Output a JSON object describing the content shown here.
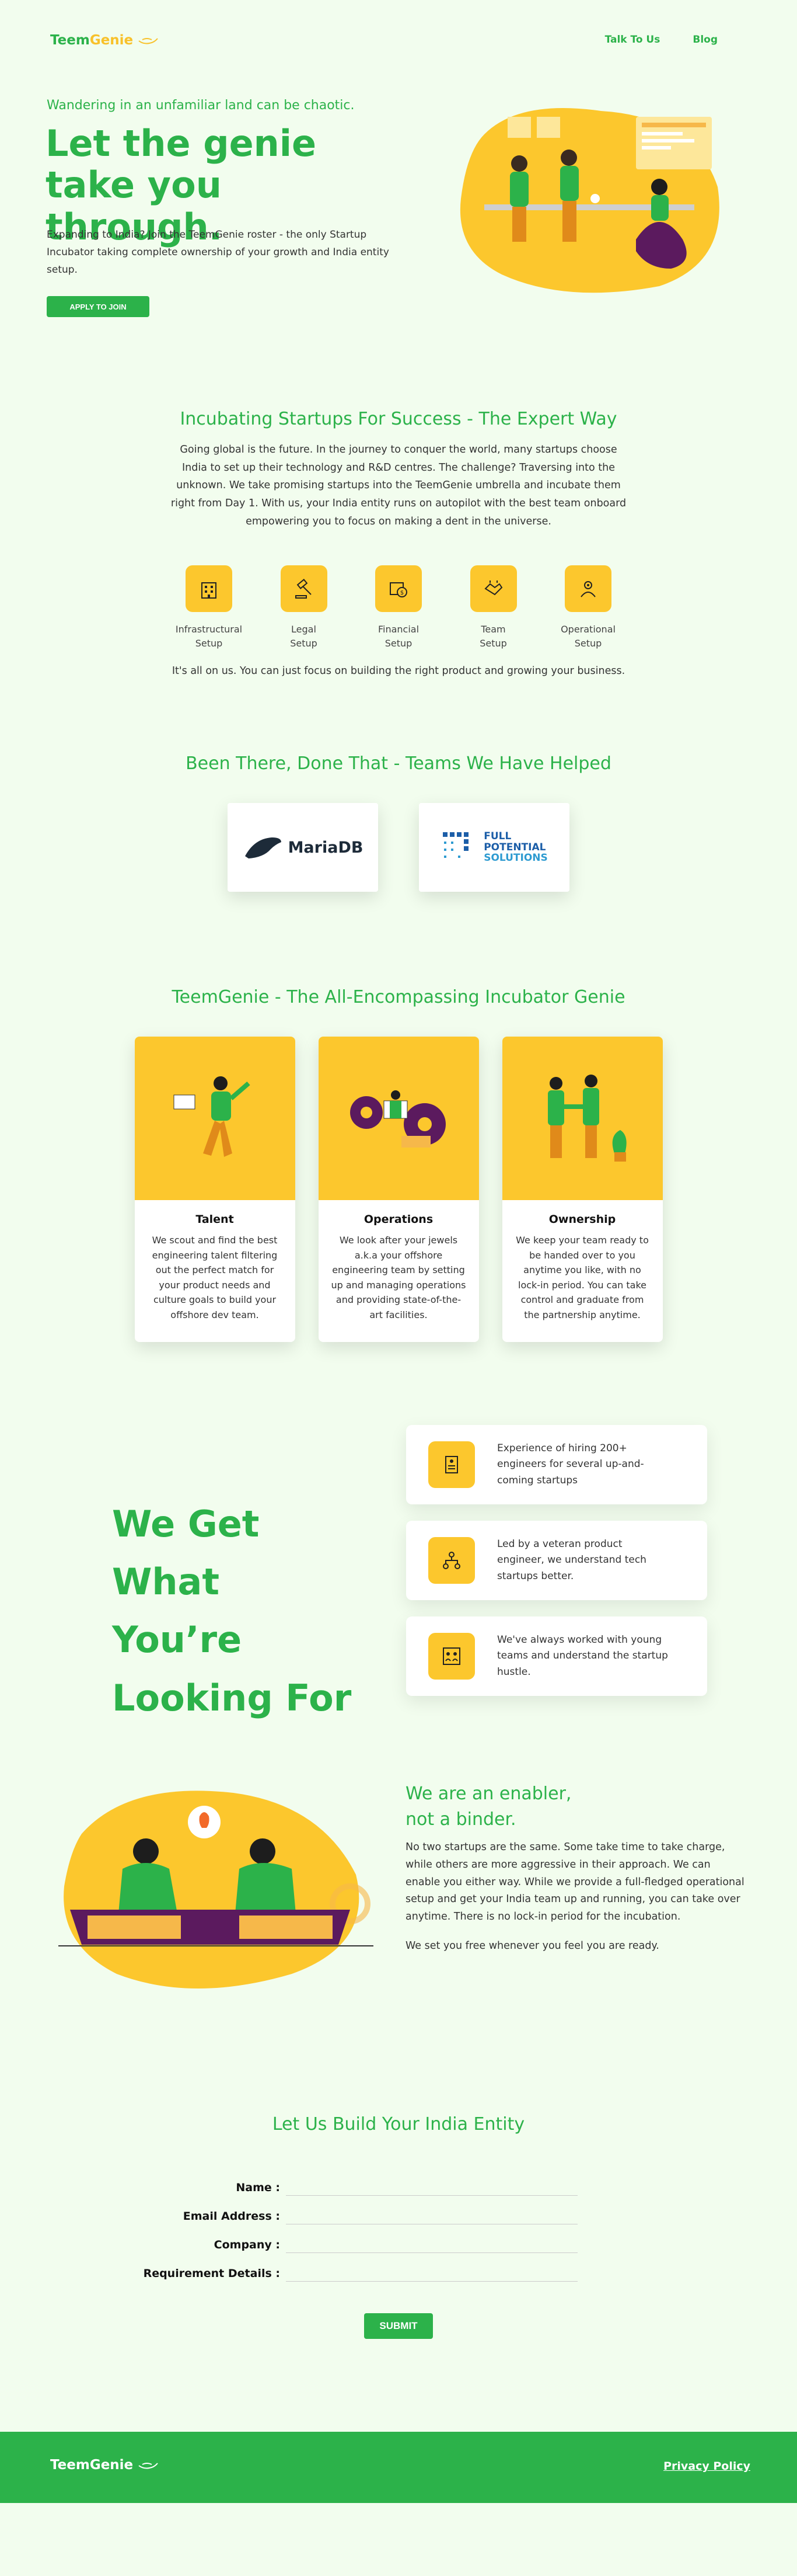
{
  "brand": {
    "name_part1": "Teem",
    "name_part2": "Genie"
  },
  "nav": {
    "talk": "Talk To Us",
    "blog": "Blog"
  },
  "hero": {
    "tagline": "Wandering in an unfamiliar land can be chaotic.",
    "title": "Let the genie take you through.",
    "description": "Expanding to India? Join the TeemGenie roster - the only Startup Incubator taking complete ownership of your growth and India entity setup.",
    "cta": "APPLY TO JOIN"
  },
  "incubating": {
    "title": "Incubating Startups For Success - The Expert Way",
    "body": "Going global is the future. In the journey to conquer the world, many startups choose India to set up their technology and R&D centres. The challenge? Traversing into the unknown. We take promising startups into the TeemGenie umbrella and incubate them right from Day 1. With us, your India entity runs on autopilot with the best team onboard empowering you to focus on making a dent in the universe.",
    "features": [
      {
        "line1": "Infrastructural",
        "line2": "Setup",
        "icon": "building-icon"
      },
      {
        "line1": "Legal",
        "line2": "Setup",
        "icon": "gavel-icon"
      },
      {
        "line1": "Financial",
        "line2": "Setup",
        "icon": "money-icon"
      },
      {
        "line1": "Team",
        "line2": "Setup",
        "icon": "handshake-icon"
      },
      {
        "line1": "Operational",
        "line2": "Setup",
        "icon": "operations-icon"
      }
    ],
    "closing": "It's all on us. You can just focus on building the right product and growing your business."
  },
  "teams": {
    "title": "Been There, Done That - Teams We Have Helped",
    "clients": [
      {
        "name": "MariaDB"
      },
      {
        "line1": "FULL",
        "line2": "POTENTIAL",
        "line3": "SOLUTIONS"
      }
    ]
  },
  "encompass": {
    "title": "TeemGenie - The All-Encompassing Incubator Genie",
    "cards": [
      {
        "title": "Talent",
        "text": "We scout and find the best engineering talent filtering out the perfect match for your product needs and culture goals to build your offshore dev team."
      },
      {
        "title": "Operations",
        "text": "We look after your jewels a.k.a your offshore engineering team by setting up and managing operations and providing state-of-the-art facilities."
      },
      {
        "title": "Ownership",
        "text": "We keep your team ready to be handed over to you anytime you like, with no lock-in period. You can take control and graduate from the partnership anytime."
      }
    ]
  },
  "weget": {
    "line1": "We Get",
    "line2": "What",
    "line3": "You’re",
    "line4": "Looking For",
    "items": [
      {
        "text": "Experience of hiring 200+ engineers for several up-and-coming startups",
        "icon": "resume-icon"
      },
      {
        "text": "Led by a veteran product engineer, we understand tech startups better.",
        "icon": "org-chart-icon"
      },
      {
        "text": "We've always worked with young teams and understand the startup hustle.",
        "icon": "team-icon"
      }
    ]
  },
  "enabler": {
    "title_line1": "We are an enabler,",
    "title_line2": "not a binder.",
    "p1": "No two startups are the same. Some take time to take charge, while others are more aggressive in their approach. We can enable you either way. While we provide a full-fledged operational setup and get your India team up and running, you can take over anytime. There is no lock-in period for the incubation.",
    "p2": "We set you free whenever you feel you are ready."
  },
  "form": {
    "title": "Let Us Build Your India Entity",
    "fields": [
      "Name :",
      "Email Address :",
      "Company :",
      "Requirement Details :"
    ],
    "submit": "SUBMIT"
  },
  "footer": {
    "privacy": "Privacy Policy"
  },
  "colors": {
    "green": "#2cb24a",
    "yellow": "#fcc72d"
  }
}
